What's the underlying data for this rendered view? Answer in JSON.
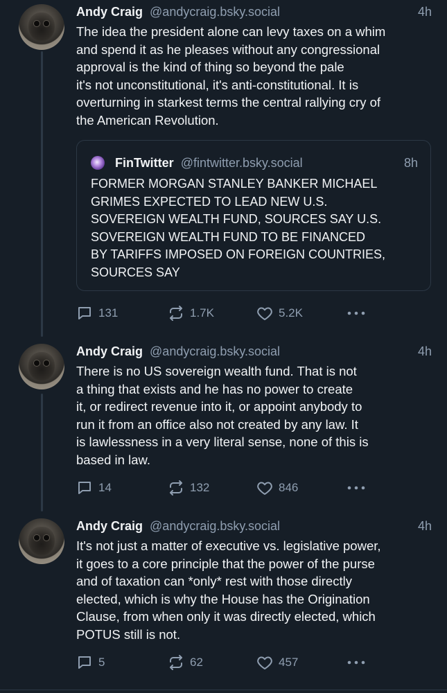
{
  "posts": [
    {
      "author_name": "Andy Craig",
      "handle": "@andycraig.bsky.social",
      "time": "4h",
      "text": "The idea the president alone can levy taxes on a whim\nand spend it as he pleases without any congressional\napproval is the kind of thing so beyond the pale\nit's not unconstitutional, it's anti-constitutional. It is\noverturning in starkest terms the central rallying cry of\nthe American Revolution.",
      "quote": {
        "author_name": "FinTwitter",
        "handle": "@fintwitter.bsky.social",
        "time": "8h",
        "text": "FORMER MORGAN STANLEY BANKER MICHAEL\nGRIMES EXPECTED TO LEAD NEW U.S.\nSOVEREIGN WEALTH FUND, SOURCES SAY U.S.\nSOVEREIGN WEALTH FUND TO BE FINANCED\nBY TARIFFS IMPOSED ON FOREIGN COUNTRIES,\nSOURCES SAY"
      },
      "replies": "131",
      "reposts": "1.7K",
      "likes": "5.2K"
    },
    {
      "author_name": "Andy Craig",
      "handle": "@andycraig.bsky.social",
      "time": "4h",
      "text": "There is no US sovereign wealth fund. That is not\na thing that exists and he has no power to create\nit, or redirect revenue into it, or appoint anybody to\nrun it from an office also not created by any law. It\nis lawlessness in a very literal sense, none of this is\nbased in law.",
      "replies": "14",
      "reposts": "132",
      "likes": "846"
    },
    {
      "author_name": "Andy Craig",
      "handle": "@andycraig.bsky.social",
      "time": "4h",
      "text": "It's not just a matter of executive vs. legislative power,\nit goes to a core principle that the power of the purse\nand of taxation can *only* rest with those directly\nelected, which is why the House has the Origination\nClause, from when only it was directly elected, which\nPOTUS still is not.",
      "replies": "5",
      "reposts": "62",
      "likes": "457"
    }
  ],
  "icons": {
    "reply": "speech-bubble-icon",
    "repost": "repost-arrows-icon",
    "like": "heart-icon",
    "more": "ellipsis-icon"
  },
  "colors": {
    "background": "#161e27",
    "text": "#f1f3f5",
    "muted": "#8f9eb0",
    "border": "#2c3845"
  }
}
